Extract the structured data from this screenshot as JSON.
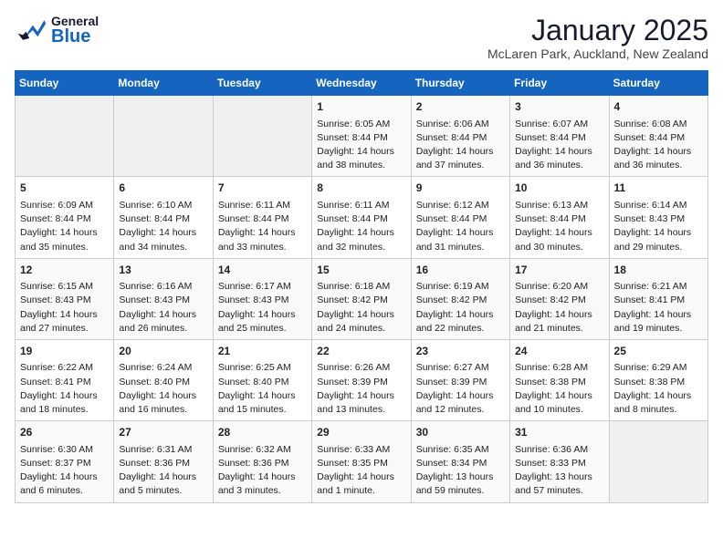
{
  "header": {
    "logo_general": "General",
    "logo_blue": "Blue",
    "title": "January 2025",
    "location": "McLaren Park, Auckland, New Zealand"
  },
  "days_of_week": [
    "Sunday",
    "Monday",
    "Tuesday",
    "Wednesday",
    "Thursday",
    "Friday",
    "Saturday"
  ],
  "weeks": [
    [
      {
        "day": "",
        "info": ""
      },
      {
        "day": "",
        "info": ""
      },
      {
        "day": "",
        "info": ""
      },
      {
        "day": "1",
        "info": "Sunrise: 6:05 AM\nSunset: 8:44 PM\nDaylight: 14 hours\nand 38 minutes."
      },
      {
        "day": "2",
        "info": "Sunrise: 6:06 AM\nSunset: 8:44 PM\nDaylight: 14 hours\nand 37 minutes."
      },
      {
        "day": "3",
        "info": "Sunrise: 6:07 AM\nSunset: 8:44 PM\nDaylight: 14 hours\nand 36 minutes."
      },
      {
        "day": "4",
        "info": "Sunrise: 6:08 AM\nSunset: 8:44 PM\nDaylight: 14 hours\nand 36 minutes."
      }
    ],
    [
      {
        "day": "5",
        "info": "Sunrise: 6:09 AM\nSunset: 8:44 PM\nDaylight: 14 hours\nand 35 minutes."
      },
      {
        "day": "6",
        "info": "Sunrise: 6:10 AM\nSunset: 8:44 PM\nDaylight: 14 hours\nand 34 minutes."
      },
      {
        "day": "7",
        "info": "Sunrise: 6:11 AM\nSunset: 8:44 PM\nDaylight: 14 hours\nand 33 minutes."
      },
      {
        "day": "8",
        "info": "Sunrise: 6:11 AM\nSunset: 8:44 PM\nDaylight: 14 hours\nand 32 minutes."
      },
      {
        "day": "9",
        "info": "Sunrise: 6:12 AM\nSunset: 8:44 PM\nDaylight: 14 hours\nand 31 minutes."
      },
      {
        "day": "10",
        "info": "Sunrise: 6:13 AM\nSunset: 8:44 PM\nDaylight: 14 hours\nand 30 minutes."
      },
      {
        "day": "11",
        "info": "Sunrise: 6:14 AM\nSunset: 8:43 PM\nDaylight: 14 hours\nand 29 minutes."
      }
    ],
    [
      {
        "day": "12",
        "info": "Sunrise: 6:15 AM\nSunset: 8:43 PM\nDaylight: 14 hours\nand 27 minutes."
      },
      {
        "day": "13",
        "info": "Sunrise: 6:16 AM\nSunset: 8:43 PM\nDaylight: 14 hours\nand 26 minutes."
      },
      {
        "day": "14",
        "info": "Sunrise: 6:17 AM\nSunset: 8:43 PM\nDaylight: 14 hours\nand 25 minutes."
      },
      {
        "day": "15",
        "info": "Sunrise: 6:18 AM\nSunset: 8:42 PM\nDaylight: 14 hours\nand 24 minutes."
      },
      {
        "day": "16",
        "info": "Sunrise: 6:19 AM\nSunset: 8:42 PM\nDaylight: 14 hours\nand 22 minutes."
      },
      {
        "day": "17",
        "info": "Sunrise: 6:20 AM\nSunset: 8:42 PM\nDaylight: 14 hours\nand 21 minutes."
      },
      {
        "day": "18",
        "info": "Sunrise: 6:21 AM\nSunset: 8:41 PM\nDaylight: 14 hours\nand 19 minutes."
      }
    ],
    [
      {
        "day": "19",
        "info": "Sunrise: 6:22 AM\nSunset: 8:41 PM\nDaylight: 14 hours\nand 18 minutes."
      },
      {
        "day": "20",
        "info": "Sunrise: 6:24 AM\nSunset: 8:40 PM\nDaylight: 14 hours\nand 16 minutes."
      },
      {
        "day": "21",
        "info": "Sunrise: 6:25 AM\nSunset: 8:40 PM\nDaylight: 14 hours\nand 15 minutes."
      },
      {
        "day": "22",
        "info": "Sunrise: 6:26 AM\nSunset: 8:39 PM\nDaylight: 14 hours\nand 13 minutes."
      },
      {
        "day": "23",
        "info": "Sunrise: 6:27 AM\nSunset: 8:39 PM\nDaylight: 14 hours\nand 12 minutes."
      },
      {
        "day": "24",
        "info": "Sunrise: 6:28 AM\nSunset: 8:38 PM\nDaylight: 14 hours\nand 10 minutes."
      },
      {
        "day": "25",
        "info": "Sunrise: 6:29 AM\nSunset: 8:38 PM\nDaylight: 14 hours\nand 8 minutes."
      }
    ],
    [
      {
        "day": "26",
        "info": "Sunrise: 6:30 AM\nSunset: 8:37 PM\nDaylight: 14 hours\nand 6 minutes."
      },
      {
        "day": "27",
        "info": "Sunrise: 6:31 AM\nSunset: 8:36 PM\nDaylight: 14 hours\nand 5 minutes."
      },
      {
        "day": "28",
        "info": "Sunrise: 6:32 AM\nSunset: 8:36 PM\nDaylight: 14 hours\nand 3 minutes."
      },
      {
        "day": "29",
        "info": "Sunrise: 6:33 AM\nSunset: 8:35 PM\nDaylight: 14 hours\nand 1 minute."
      },
      {
        "day": "30",
        "info": "Sunrise: 6:35 AM\nSunset: 8:34 PM\nDaylight: 13 hours\nand 59 minutes."
      },
      {
        "day": "31",
        "info": "Sunrise: 6:36 AM\nSunset: 8:33 PM\nDaylight: 13 hours\nand 57 minutes."
      },
      {
        "day": "",
        "info": ""
      }
    ]
  ]
}
